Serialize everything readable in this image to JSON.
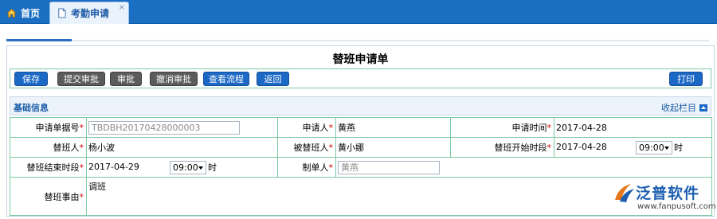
{
  "tabs": [
    {
      "label": "首页",
      "icon": "home-icon"
    },
    {
      "label": "考勤申请",
      "icon": "document-icon",
      "close": "×"
    }
  ],
  "form": {
    "title": "替班申请单"
  },
  "toolbar": {
    "save": "保存",
    "submit": "提交审批",
    "approve": "审批",
    "revoke": "撤消审批",
    "flow": "查看流程",
    "back": "返回",
    "print": "打印"
  },
  "section": {
    "title": "基础信息",
    "collapse": "收起栏目"
  },
  "fields": {
    "doc_no_label": "申请单据号",
    "doc_no": "TBDBH20170428000003",
    "applicant_label": "申请人",
    "applicant": "黄燕",
    "apply_time_label": "申请时间",
    "apply_time": "2017-04-28",
    "substitute_label": "替班人",
    "substitute": "杨小波",
    "replaced_label": "被替班人",
    "replaced": "黄小娜",
    "start_label": "替班开始时段",
    "start_date": "2017-04-28",
    "start_time": "09:00",
    "end_label": "替班结束时段",
    "end_date": "2017-04-29",
    "end_time": "09:00",
    "creator_label": "制单人",
    "creator": "黄燕",
    "reason_label": "替班事由",
    "reason": "调班",
    "hour_unit": "时",
    "required_mark": "*"
  },
  "watermark": {
    "brand": "泛普软件",
    "url": "www.fanpusoft.com"
  },
  "colors": {
    "tabbar": "#1a6fc2",
    "button_blue": "#1b68c5",
    "button_gray": "#5b5b5b",
    "grid_border": "#7dc9a4",
    "section_bg": "#edf3fa"
  }
}
